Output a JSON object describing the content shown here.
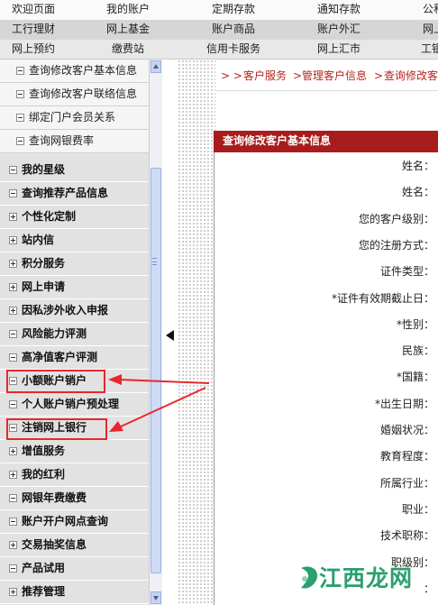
{
  "top_nav": {
    "row1": [
      "欢迎页面",
      "我的账户",
      "定期存款",
      "通知存款",
      "公积金"
    ],
    "row2": [
      "工行理财",
      "网上基金",
      "账户商品",
      "账户外汇",
      "网上"
    ],
    "row3": [
      "网上预约",
      "缴费站",
      "信用卡服务",
      "网上汇市",
      "工银"
    ]
  },
  "sidebar": {
    "sub_items": [
      "查询修改客户基本信息",
      "查询修改客户联络信息",
      "绑定门户会员关系",
      "查询网银费率"
    ],
    "top_items": [
      {
        "label": "我的星级",
        "icon": "minus"
      },
      {
        "label": "查询推荐产品信息",
        "icon": "minus"
      },
      {
        "label": "个性化定制",
        "icon": "plus"
      },
      {
        "label": "站内信",
        "icon": "plus"
      },
      {
        "label": "积分服务",
        "icon": "plus"
      },
      {
        "label": "网上申请",
        "icon": "plus"
      },
      {
        "label": "因私涉外收入申报",
        "icon": "plus"
      },
      {
        "label": "风险能力评测",
        "icon": "minus"
      },
      {
        "label": "高净值客户评测",
        "icon": "minus"
      },
      {
        "label": "小额账户销户",
        "icon": "minus"
      },
      {
        "label": "个人账户销户预处理",
        "icon": "minus"
      },
      {
        "label": "注销网上银行",
        "icon": "minus"
      },
      {
        "label": "增值服务",
        "icon": "plus"
      },
      {
        "label": "我的红利",
        "icon": "plus"
      },
      {
        "label": "网银年费缴费",
        "icon": "minus"
      },
      {
        "label": "账户开户网点查询",
        "icon": "minus"
      },
      {
        "label": "交易抽奖信息",
        "icon": "plus"
      },
      {
        "label": "产品试用",
        "icon": "minus"
      },
      {
        "label": "推荐管理",
        "icon": "plus"
      }
    ]
  },
  "breadcrumb": {
    "prefix": "> >",
    "items": [
      "客户服务",
      "管理客户信息",
      "查询修改客"
    ],
    "separator": ">"
  },
  "panel": {
    "title": "查询修改客户基本信息",
    "fields": [
      "姓名：",
      "姓名：",
      "您的客户级别：",
      "您的注册方式：",
      "证件类型：",
      "*证件有效期截止日：",
      "*性别：",
      "民族：",
      "*国籍：",
      "*出生日期：",
      "婚姻状况：",
      "教育程度：",
      "所属行业：",
      "职业：",
      "技术职称：",
      "职级别：",
      "："
    ]
  },
  "watermark": {
    "text": "江西龙网"
  },
  "colors": {
    "accent": "#a81c1c",
    "breadcrumb": "#b5261e",
    "annotation": "#e8272c",
    "watermark": "#2a9f6f"
  }
}
